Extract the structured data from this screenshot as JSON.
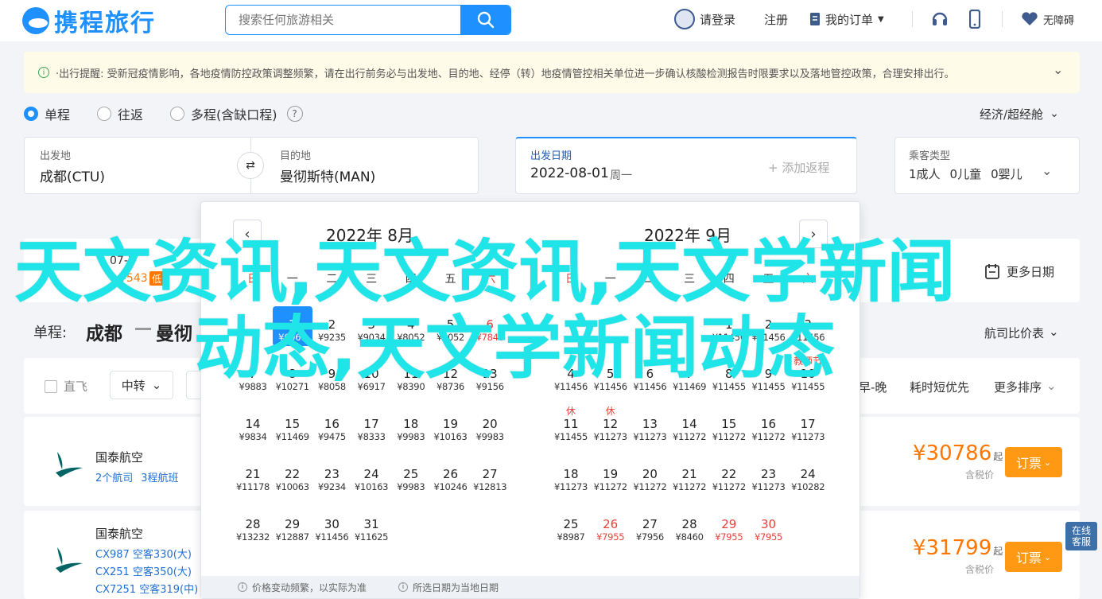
{
  "header": {
    "logo_text": "携程旅行",
    "search_placeholder": "搜索任何旅游相关",
    "login": "请登录",
    "register": "注册",
    "orders": "我的订单",
    "accessible": "无障碍"
  },
  "notice": {
    "text": "·出行提醒: 受新冠疫情影响，各地疫情防控政策调整频繁，请在出行前务必与出发地、目的地、经停（转）地疫情管控相关单位进一步确认核酸检测报告时限要求以及落地管控政策，合理安排出行。"
  },
  "trip_types": [
    "单程",
    "往返",
    "多程(含缺口程)"
  ],
  "cabin": "经济/超经舱",
  "search_form": {
    "from_label": "出发地",
    "from_value": "成都(CTU)",
    "to_label": "目的地",
    "to_value": "曼彻斯特(MAN)",
    "date_label": "出发日期",
    "date_value": "2022-08-01",
    "weekday": "周一",
    "add_return": "+ 添加返程",
    "pax_label": "乘客类型",
    "adults": "1成人",
    "children": "0儿童",
    "infants": "0婴儿"
  },
  "strip": {
    "date_frag": "07-3",
    "price_frag": "¥543",
    "low_badge": "低",
    "more_dates": "更多日期"
  },
  "route": {
    "prefix": "单程:",
    "from": "成都",
    "to": "曼彻",
    "compare": "航司比价表"
  },
  "filters": {
    "direct": "直飞",
    "transfer": "中转",
    "early_late": "早-晚",
    "shortest": "耗时短优先",
    "more_sort": "更多排序"
  },
  "flights": [
    {
      "airline": "国泰航空",
      "details": [
        "2个航司",
        "3程航班"
      ],
      "price": "¥30786",
      "qi": "起",
      "tax": "含税价",
      "book": "订票"
    },
    {
      "airline": "国泰航空",
      "details": [
        "CX987 空客330(大)",
        "CX251 空客350(大)",
        "CX7251 空客319(中)"
      ],
      "price": "¥31799",
      "qi": "起",
      "tax": "含税价",
      "book": "订票"
    }
  ],
  "calendar": {
    "weekdays": [
      "日",
      "一",
      "二",
      "三",
      "四",
      "五",
      "六"
    ],
    "months": [
      {
        "title": "2022年 8月",
        "rows": [
          [
            null,
            {
              "d": "1",
              "p": "¥6061",
              "sel": true
            },
            {
              "d": "2",
              "p": "¥9235"
            },
            {
              "d": "3",
              "p": "¥9034"
            },
            {
              "d": "4",
              "p": "¥8052"
            },
            {
              "d": "5",
              "p": "¥8052"
            },
            {
              "d": "6",
              "p": "¥7840",
              "red": true
            }
          ],
          [
            {
              "d": "7",
              "p": "¥9883"
            },
            {
              "d": "8",
              "p": "¥10271"
            },
            {
              "d": "9",
              "p": "¥8058"
            },
            {
              "d": "10",
              "p": "¥6917"
            },
            {
              "d": "11",
              "p": "¥8390"
            },
            {
              "d": "12",
              "p": "¥8736"
            },
            {
              "d": "13",
              "p": "¥9156"
            }
          ],
          [
            {
              "d": "14",
              "p": "¥9834"
            },
            {
              "d": "15",
              "p": "¥11469"
            },
            {
              "d": "16",
              "p": "¥9475"
            },
            {
              "d": "17",
              "p": "¥8333"
            },
            {
              "d": "18",
              "p": "¥9983"
            },
            {
              "d": "19",
              "p": "¥10163"
            },
            {
              "d": "20",
              "p": "¥9983"
            }
          ],
          [
            {
              "d": "21",
              "p": "¥11178"
            },
            {
              "d": "22",
              "p": "¥10063"
            },
            {
              "d": "23",
              "p": "¥9234"
            },
            {
              "d": "24",
              "p": "¥10163"
            },
            {
              "d": "25",
              "p": "¥9983"
            },
            {
              "d": "26",
              "p": "¥10246"
            },
            {
              "d": "27",
              "p": "¥12813"
            }
          ],
          [
            {
              "d": "28",
              "p": "¥13232"
            },
            {
              "d": "29",
              "p": "¥12887"
            },
            {
              "d": "30",
              "p": "¥11456"
            },
            {
              "d": "31",
              "p": "¥11625"
            },
            null,
            null,
            null
          ]
        ]
      },
      {
        "title": "2022年 9月",
        "rows": [
          [
            null,
            null,
            null,
            null,
            {
              "d": "1",
              "p": "¥11456"
            },
            {
              "d": "2",
              "p": "¥11456"
            },
            {
              "d": "3",
              "p": "¥11456"
            }
          ],
          [
            {
              "d": "4",
              "p": "¥11456"
            },
            {
              "d": "5",
              "p": "¥11456"
            },
            {
              "d": "6",
              "p": "¥11456"
            },
            {
              "d": "7",
              "p": "¥11469"
            },
            {
              "d": "8",
              "p": "¥11455"
            },
            {
              "d": "9",
              "p": "¥11455"
            },
            {
              "d": "10",
              "p": "¥11455",
              "tag": "教师节"
            }
          ],
          [
            {
              "d": "11",
              "p": "¥11455",
              "tag": "休"
            },
            {
              "d": "12",
              "p": "¥11273",
              "tag": "休"
            },
            {
              "d": "13",
              "p": "¥11273"
            },
            {
              "d": "14",
              "p": "¥11272"
            },
            {
              "d": "15",
              "p": "¥11272"
            },
            {
              "d": "16",
              "p": "¥11272"
            },
            {
              "d": "17",
              "p": "¥11273"
            }
          ],
          [
            {
              "d": "18",
              "p": "¥11273"
            },
            {
              "d": "19",
              "p": "¥11272"
            },
            {
              "d": "20",
              "p": "¥11272"
            },
            {
              "d": "21",
              "p": "¥11272"
            },
            {
              "d": "22",
              "p": "¥11272"
            },
            {
              "d": "23",
              "p": "¥11273"
            },
            {
              "d": "24",
              "p": "¥10282"
            }
          ],
          [
            {
              "d": "25",
              "p": "¥8987"
            },
            {
              "d": "26",
              "p": "¥7955",
              "red": true
            },
            {
              "d": "27",
              "p": "¥7956"
            },
            {
              "d": "28",
              "p": "¥8460"
            },
            {
              "d": "29",
              "p": "¥7955",
              "red": true
            },
            {
              "d": "30",
              "p": "¥7955",
              "red": true
            },
            null
          ]
        ]
      }
    ],
    "footer": [
      "价格变动频繁，以实际为准",
      "所选日期为当地日期"
    ]
  },
  "overlay": {
    "line1": "天文资讯,天文资讯,天文学新闻",
    "line2": "动态,天文学新闻动态"
  },
  "online_chip": [
    "在线",
    "客服"
  ]
}
